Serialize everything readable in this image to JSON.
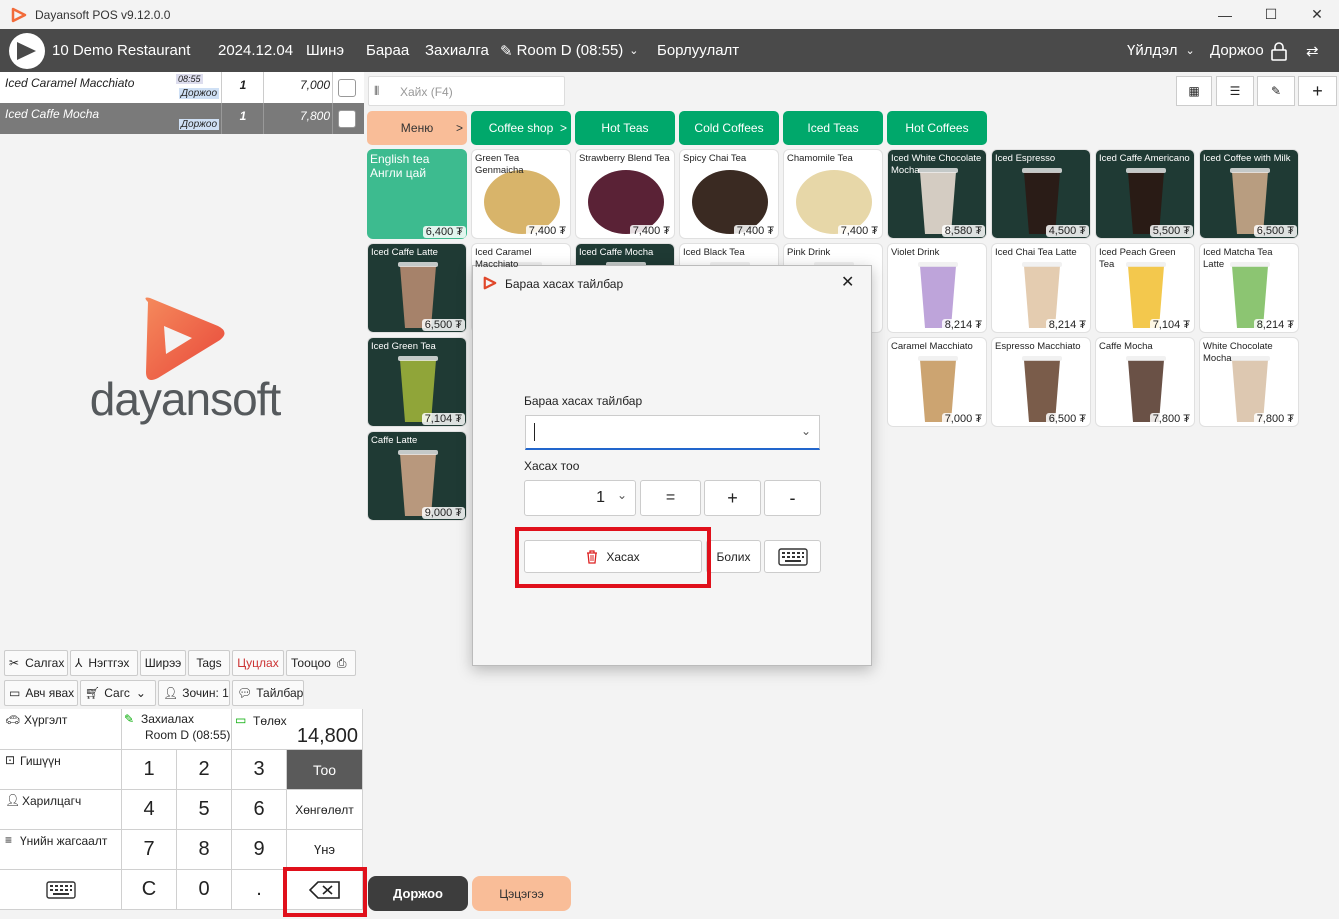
{
  "window": {
    "title": "Dayansoft POS v9.12.0.0"
  },
  "nav": {
    "restaurant": "10 Demo Restaurant",
    "date": "2024.12.04",
    "new": "Шинэ",
    "items": "Бараа",
    "orders": "Захиалга",
    "room": "Room D (08:55)",
    "sales": "Борлуулалт",
    "operation": "Үйлдэл",
    "waiter": "Доржоо"
  },
  "order_lines": [
    {
      "name": "Iced Caramel Macchiato",
      "time": "08:55",
      "waiter": "Доржоо",
      "qty": "1",
      "price": "7,000"
    },
    {
      "name": "Iced Caffe Mocha",
      "time": "",
      "waiter": "Доржоо",
      "qty": "1",
      "price": "7,800"
    }
  ],
  "brand": {
    "logo_text": "dayansoft"
  },
  "actions_row1": {
    "cut": "Салгах",
    "merge": "Нэгтгэх",
    "table": "Ширээ",
    "tags": "Tags",
    "cancel": "Цуцлах",
    "print": "Тооцоо"
  },
  "actions_row2": {
    "takeaway": "Авч явах",
    "cart": "Сагс",
    "guests": "Зочин: 1",
    "note": "Тайлбар"
  },
  "info": {
    "delivery": "Хүргэлт",
    "order_label": "Захиалах",
    "order_room": "Room D (08:55)",
    "pay_label": "Төлөх",
    "total": "14,800",
    "member": "Гишүүн",
    "customer": "Харилцагч",
    "price_list": "Үнийн жагсаалт"
  },
  "numpad": {
    "k1": "1",
    "k2": "2",
    "k3": "3",
    "k4": "4",
    "k5": "5",
    "k6": "6",
    "k7": "7",
    "k8": "8",
    "k9": "9",
    "kc": "C",
    "k0": "0",
    "kdot": ".",
    "qty": "Тоо",
    "discount": "Хөнгөлөлт",
    "price": "Үнэ"
  },
  "bottom_buttons": {
    "waiter": "Доржоо",
    "clear": "Цэцэгээ"
  },
  "search": {
    "placeholder": "Хайх (F4)"
  },
  "categories": [
    "Меню",
    "Coffee shop",
    "Hot Teas",
    "Cold Coffees",
    "Iced Teas",
    "Hot Coffees"
  ],
  "products": [
    {
      "name": "English tea\nАнгли цай",
      "price": "6,400 ₮"
    },
    {
      "name": "Green Tea Genmaicha",
      "price": "7,400 ₮"
    },
    {
      "name": "Strawberry Blend Tea",
      "price": "7,400 ₮"
    },
    {
      "name": "Spicy Chai Tea",
      "price": "7,400 ₮"
    },
    {
      "name": "Chamomile Tea",
      "price": "7,400 ₮"
    },
    {
      "name": "Iced White Chocolate Mocha",
      "price": "8,580 ₮"
    },
    {
      "name": "Iced Espresso",
      "price": "4,500 ₮"
    },
    {
      "name": "Iced Caffe Americano",
      "price": "5,500 ₮"
    },
    {
      "name": "Iced Coffee with Milk",
      "price": "6,500 ₮"
    },
    {
      "name": "Iced Caffe Latte",
      "price": "6,500 ₮"
    },
    {
      "name": "Iced Caramel Macchiato",
      "price": ""
    },
    {
      "name": "Iced Caffe Mocha",
      "price": ""
    },
    {
      "name": "Iced Black Tea",
      "price": ""
    },
    {
      "name": "Pink Drink",
      "price": ""
    },
    {
      "name": "Violet Drink",
      "price": "8,214 ₮"
    },
    {
      "name": "Iced Chai Tea Latte",
      "price": "8,214 ₮"
    },
    {
      "name": "Iced Peach Green Tea",
      "price": "7,104 ₮"
    },
    {
      "name": "Iced Matcha Tea Latte",
      "price": "8,214 ₮"
    },
    {
      "name": "Iced Green Tea",
      "price": "7,104 ₮"
    },
    {
      "name": "Caramel Macchiato",
      "price": "7,000 ₮"
    },
    {
      "name": "Espresso Macchiato",
      "price": "6,500 ₮"
    },
    {
      "name": "Caffe Mocha",
      "price": "7,800 ₮"
    },
    {
      "name": "White Chocolate Mocha",
      "price": "7,800 ₮"
    },
    {
      "name": "Caffe Latte",
      "price": "9,000 ₮"
    }
  ],
  "dialog": {
    "title": "Бараа хасах тайлбар",
    "field_label": "Бараа хасах тайлбар",
    "qty_label": "Хасах тоо",
    "qty_value": "1",
    "equals": "=",
    "plus": "+",
    "minus": "-",
    "remove": "Хасах",
    "cancel": "Болих"
  },
  "colors": {
    "nav_bg": "#4a4a4a",
    "green": "#00a86b",
    "menu_orange": "#f9bd98",
    "highlight_red": "#e0101b",
    "brand_orange": "#f26b3a"
  }
}
